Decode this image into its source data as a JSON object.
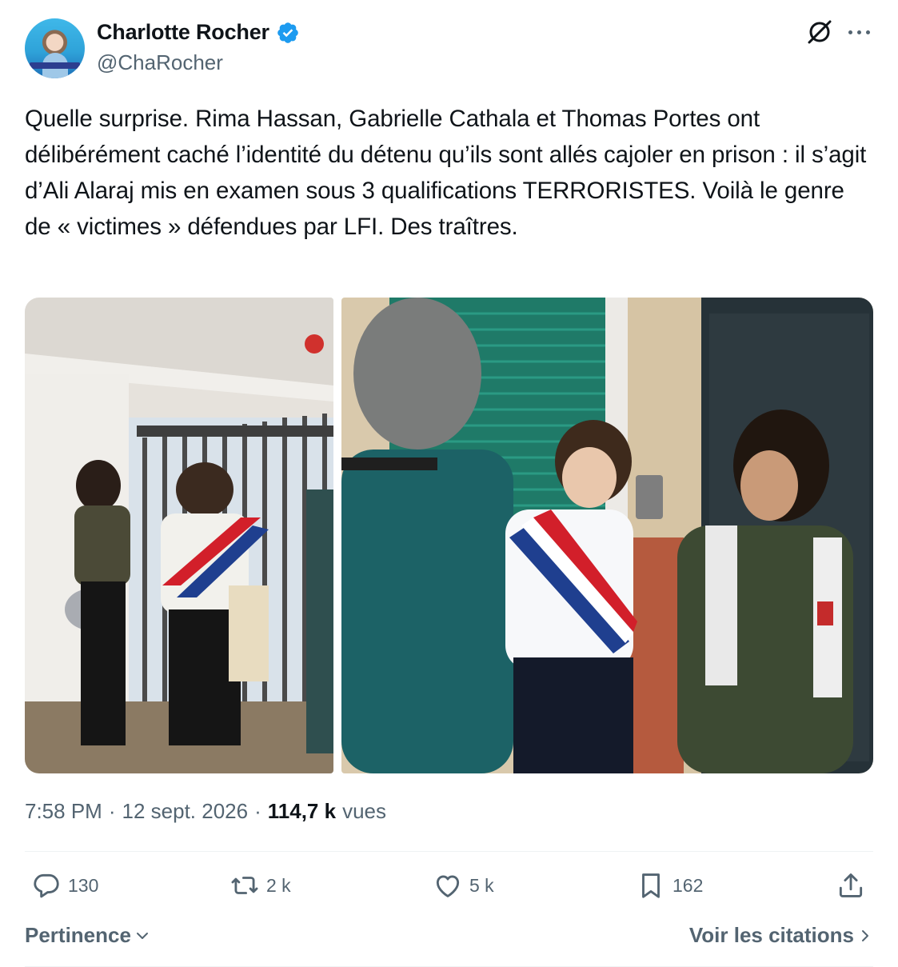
{
  "author": {
    "display_name": "Charlotte Rocher",
    "handle": "@ChaRocher",
    "verified": true,
    "verified_color": "#1d9bf0"
  },
  "tweet": {
    "text": "Quelle surprise. Rima Hassan, Gabrielle Cathala et Thomas Portes ont délibérément caché l’identité du détenu qu’ils sont allés cajoler en prison : il s’agit d’Ali Alaraj mis en examen sous 3 qualifications TERRORISTES. Voilà le genre de « victimes » défendues par LFI. Des traîtres.",
    "time": "7:58 PM",
    "separator": "·",
    "date": "12 sept. 2026",
    "views_count": "114,7 k",
    "views_label": "vues"
  },
  "media": [
    {
      "name": "photo-prison-corridor",
      "icon": "photo-icon"
    },
    {
      "name": "photo-deputies-at-door",
      "icon": "photo-icon"
    }
  ],
  "actions": {
    "replies": "130",
    "reposts": "2 k",
    "likes": "5 k",
    "bookmarks": "162"
  },
  "footer": {
    "sort_label": "Pertinence",
    "quotes_link": "Voir les citations"
  },
  "colors": {
    "text_primary": "#0f1419",
    "text_secondary": "#536471",
    "divider": "#eff3f4"
  }
}
